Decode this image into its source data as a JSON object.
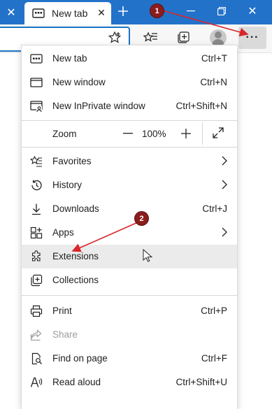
{
  "browser": {
    "active_tab_title": "New tab",
    "new_tab_symbol": "+",
    "more_button_label": "···"
  },
  "menu": {
    "items_group1": [
      {
        "label": "New tab",
        "shortcut": "Ctrl+T",
        "icon": "new-tab-icon"
      },
      {
        "label": "New window",
        "shortcut": "Ctrl+N",
        "icon": "window-icon"
      },
      {
        "label": "New InPrivate window",
        "shortcut": "Ctrl+Shift+N",
        "icon": "inprivate-icon"
      }
    ],
    "zoom": {
      "label": "Zoom",
      "minus": "—",
      "value": "100%",
      "plus": "+",
      "fullscreen_icon": "fullscreen-icon"
    },
    "items_group2": [
      {
        "label": "Favorites",
        "icon": "favorites-icon",
        "submenu": true
      },
      {
        "label": "History",
        "icon": "history-icon",
        "submenu": true
      },
      {
        "label": "Downloads",
        "shortcut": "Ctrl+J",
        "icon": "download-icon"
      },
      {
        "label": "Apps",
        "icon": "apps-icon",
        "submenu": true
      },
      {
        "label": "Extensions",
        "icon": "extensions-icon",
        "highlighted": true
      },
      {
        "label": "Collections",
        "icon": "collections-icon"
      }
    ],
    "items_group3": [
      {
        "label": "Print",
        "shortcut": "Ctrl+P",
        "icon": "print-icon"
      },
      {
        "label": "Share",
        "icon": "share-icon",
        "disabled": true
      },
      {
        "label": "Find on page",
        "shortcut": "Ctrl+F",
        "icon": "find-icon"
      },
      {
        "label": "Read aloud",
        "shortcut": "Ctrl+Shift+U",
        "icon": "read-aloud-icon"
      }
    ]
  },
  "annotations": {
    "step1": "1",
    "step2": "2",
    "color": "#d9262b"
  }
}
